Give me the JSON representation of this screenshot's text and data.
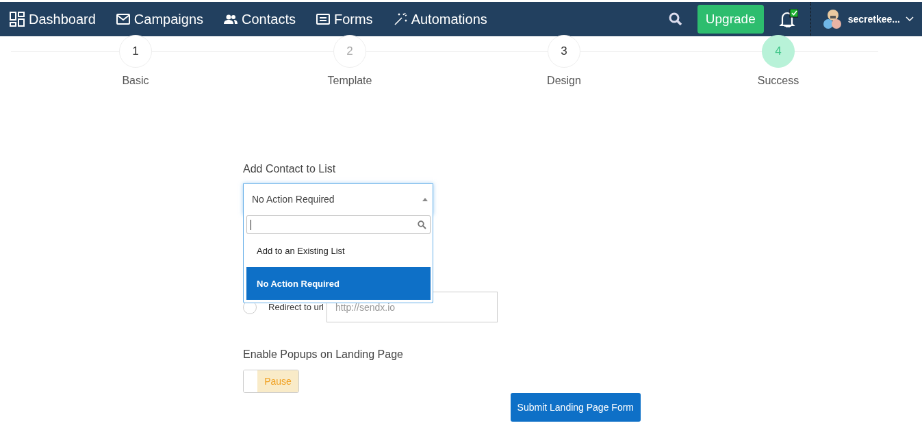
{
  "nav": {
    "items": [
      {
        "kind": "dashboard",
        "label": "Dashboard"
      },
      {
        "kind": "campaigns",
        "label": "Campaigns"
      },
      {
        "kind": "contacts",
        "label": "Contacts"
      },
      {
        "kind": "forms",
        "label": "Forms"
      },
      {
        "kind": "automations",
        "label": "Automations"
      }
    ],
    "upgrade": "Upgrade",
    "notification_checked": true,
    "user": "secretkee..."
  },
  "steps": [
    {
      "number": "1",
      "label": "Basic",
      "selected": false,
      "disabled": false
    },
    {
      "number": "2",
      "label": "Template",
      "selected": false,
      "disabled": true
    },
    {
      "number": "3",
      "label": "Design",
      "selected": false,
      "disabled": false
    },
    {
      "number": "4",
      "label": "Success",
      "selected": true,
      "disabled": false
    }
  ],
  "contact_list": {
    "label": "Add Contact to List",
    "value": "No Action Required",
    "expanded": true,
    "options": [
      {
        "label": "Add to an Existing List",
        "selected": false
      },
      {
        "label": "No Action Required",
        "selected": true
      }
    ]
  },
  "redirect": {
    "label": "Redirect to url",
    "selected": false,
    "placeholder": "http://sendx.io"
  },
  "popups": {
    "label": "Enable Popups on Landing Page",
    "on": false,
    "state_label": "Pause"
  },
  "submit": "Submit Landing Page Form"
}
